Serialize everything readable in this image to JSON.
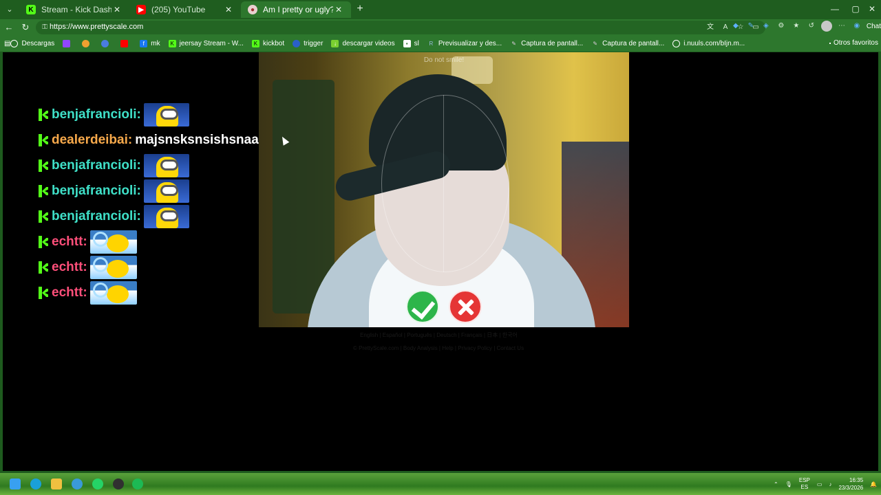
{
  "browser": {
    "tabs": [
      {
        "title": "Stream - Kick Dashboard",
        "active": false
      },
      {
        "title": "(205) YouTube",
        "active": false
      },
      {
        "title": "Am I pretty or ugly? Face bea",
        "active": true
      }
    ],
    "url": "https://www.prettyscale.com",
    "chat_label": "Chat",
    "bookmarks": [
      "Descargas",
      "mk",
      "jeersay Stream - W...",
      "kickbot",
      "trigger",
      "descargar videos",
      "sl",
      "Previsualizar y des...",
      "Captura de pantall...",
      "Captura de pantall...",
      "i.nuuls.com/bIjn.m..."
    ],
    "other_bookmarks": "Otros favoritos"
  },
  "chat": {
    "messages": [
      {
        "user": "benjafrancioli:",
        "color": "#3fe0c8",
        "emote": "minion",
        "text": ""
      },
      {
        "user": "dealerdeibai:",
        "color": "#f7a94b",
        "emote": "",
        "text": "majsnsksnsishsnaa"
      },
      {
        "user": "benjafrancioli:",
        "color": "#3fe0c8",
        "emote": "minion",
        "text": ""
      },
      {
        "user": "benjafrancioli:",
        "color": "#3fe0c8",
        "emote": "minion",
        "text": ""
      },
      {
        "user": "benjafrancioli:",
        "color": "#3fe0c8",
        "emote": "minion",
        "text": ""
      },
      {
        "user": "echtt:",
        "color": "#ff4f7a",
        "emote": "ball",
        "text": ""
      },
      {
        "user": "echtt:",
        "color": "#ff4f7a",
        "emote": "ball",
        "text": ""
      },
      {
        "user": "echtt:",
        "color": "#ff4f7a",
        "emote": "ball",
        "text": ""
      }
    ]
  },
  "camera": {
    "hint": "Do not smile!",
    "accept_icon": "check-icon",
    "reject_icon": "close-icon"
  },
  "footer": {
    "languages": "English | Español | Português | Deutsch | Français | 日本 | 한국어",
    "links": "© PrettyScale.com | Body Analysis | Help | Privacy Policy | Contact Us"
  },
  "taskbar": {
    "lang_top": "ESP",
    "lang_bottom": "ES",
    "time": "16:35",
    "date": "23/3/2026"
  }
}
